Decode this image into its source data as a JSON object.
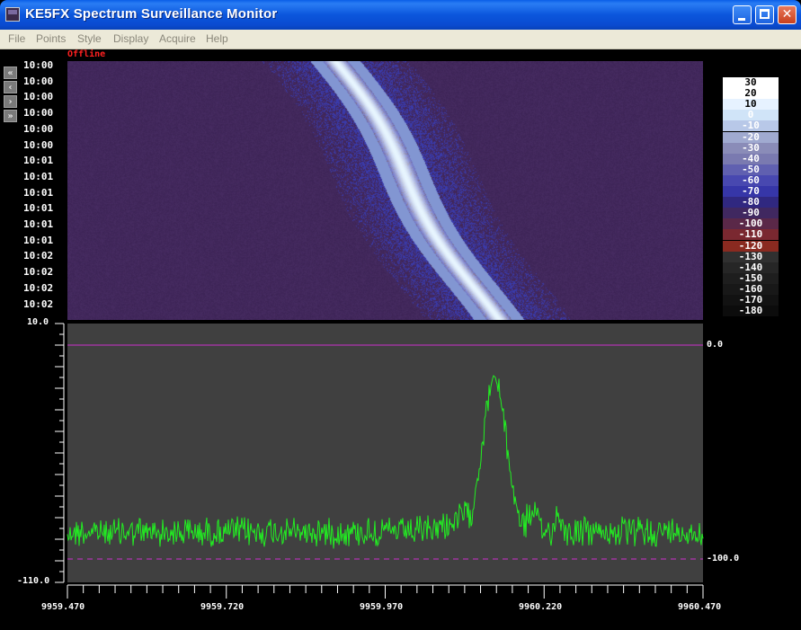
{
  "window": {
    "title": "KE5FX Spectrum Surveillance Monitor",
    "min_symbol": "",
    "max_symbol": "",
    "close_symbol": "✕"
  },
  "menu": [
    "File",
    "Points",
    "Style",
    "Display",
    "Acquire",
    "Help"
  ],
  "status": {
    "offline": "Offline"
  },
  "nav_buttons": [
    "«",
    "‹",
    "›",
    "»"
  ],
  "waterfall": {
    "timestamps": [
      "10:00",
      "10:00",
      "10:00",
      "10:00",
      "10:00",
      "10:00",
      "10:01",
      "10:01",
      "10:01",
      "10:01",
      "10:01",
      "10:01",
      "10:02",
      "10:02",
      "10:02",
      "10:02"
    ],
    "scale_labels": [
      "30",
      "20",
      "10",
      "0",
      "-10",
      "-20",
      "-30",
      "-40",
      "-50",
      "-60",
      "-70",
      "-80",
      "-90",
      "-100",
      "-110",
      "-120",
      "-130",
      "-140",
      "-150",
      "-160",
      "-170",
      "-180"
    ],
    "scale_colors": [
      "#ffffff",
      "#ffffff",
      "#e6f2ff",
      "#d0e4f8",
      "#b8c8e8",
      "#a0aad0",
      "#8a8cb8",
      "#7a7ab0",
      "#6060b0",
      "#4848b0",
      "#3636a8",
      "#302880",
      "#402860",
      "#5a2848",
      "#7a2830",
      "#8a2a20",
      "#303030",
      "#262626",
      "#1e1e1e",
      "#181818",
      "#121212",
      "#0c0c0c"
    ],
    "background": "#42285c",
    "signal_color": "#e8f6ff"
  },
  "spectrum": {
    "y_top_label": "10.0",
    "y_bottom_label": "-110.0",
    "ref_high_label": "0.0",
    "ref_low_label": "-100.0",
    "x_labels": [
      "9959.470",
      "9959.720",
      "9959.970",
      "9960.220",
      "9960.470"
    ],
    "trace_color": "#22ee22",
    "ref_color": "#cc30cc",
    "plot_bg": "#404040"
  }
}
